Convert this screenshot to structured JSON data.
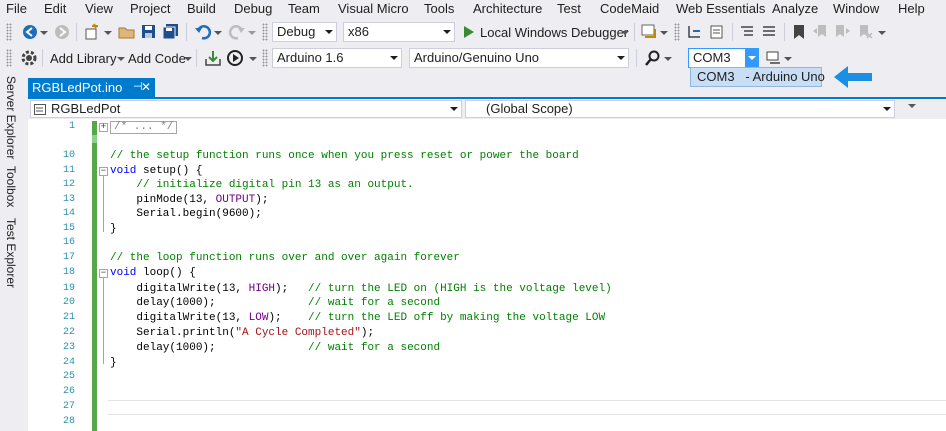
{
  "menu": [
    "File",
    "Edit",
    "View",
    "Project",
    "Build",
    "Debug",
    "Team",
    "Visual Micro",
    "Tools",
    "Architecture",
    "Test",
    "CodeMaid",
    "Web Essentials",
    "Analyze",
    "Window",
    "Help"
  ],
  "toolbar1": {
    "config": "Debug",
    "platform": "x86",
    "run_label": "Local Windows Debugger",
    "run_color": "#388a34"
  },
  "toolbar2": {
    "add_library": "Add Library",
    "add_code": "Add Code",
    "ide_version": "Arduino 1.6",
    "board": "Arduino/Genuino Uno",
    "port": "COM3"
  },
  "port_dropdown": {
    "option": "COM3   - Arduino Uno"
  },
  "annotation_arrow_color": "#1a8fe3",
  "sidebar_tabs": [
    "Server Explorer",
    "Toolbox",
    "Test Explorer"
  ],
  "document_tab": {
    "title": "RGBLedPot.ino",
    "pin": "⊣",
    "close": "✕",
    "accent": "#007acc"
  },
  "navbar": {
    "file_scope": "RGBLedPot",
    "member_scope": "(Global Scope)"
  },
  "editor": {
    "line_numbers": [
      "1",
      "10",
      "11",
      "12",
      "13",
      "14",
      "15",
      "16",
      "17",
      "18",
      "19",
      "20",
      "21",
      "22",
      "23",
      "24",
      "25",
      "26",
      "27",
      "28"
    ],
    "collapsed_text": "/* ... */",
    "line10": "// the setup function runs once when you press reset or power the board",
    "line11_kw": "void",
    "line11_rest": " setup() {",
    "line12": "    // initialize digital pin 13 as an output.",
    "line13_a": "    pinMode(13, ",
    "line13_const": "OUTPUT",
    "line13_b": ");",
    "line14": "    Serial.begin(9600);",
    "line15": "}",
    "line17": "// the loop function runs over and over again forever",
    "line18_kw": "void",
    "line18_rest": " loop() {",
    "line19_a": "    digitalWrite(13, ",
    "line19_const": "HIGH",
    "line19_b": ");   ",
    "line19_comment": "// turn the LED on (HIGH is the voltage level)",
    "line20_a": "    delay(1000);              ",
    "line20_comment": "// wait for a second",
    "line21_a": "    digitalWrite(13, ",
    "line21_const": "LOW",
    "line21_b": ");    ",
    "line21_comment": "// turn the LED off by making the voltage LOW",
    "line22_a": "    Serial.println(",
    "line22_str": "\"A Cycle Completed\"",
    "line22_b": ");",
    "line23_a": "    delay(1000);              ",
    "line23_comment": "// wait for a second",
    "line24": "}"
  }
}
